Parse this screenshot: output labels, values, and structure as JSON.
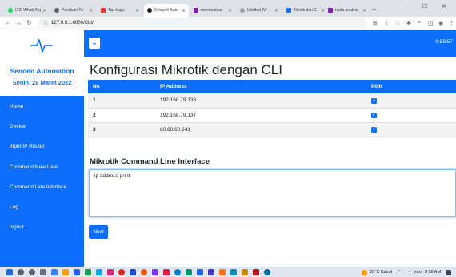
{
  "browser": {
    "tabs": [
      {
        "label": "(12) WhatsApp",
        "color": "#25d366"
      },
      {
        "label": "Panduan TA",
        "color": "#5f6368"
      },
      {
        "label": "Top Lagu",
        "color": "#e53935"
      },
      {
        "label": "Network Auto",
        "color": "#202124"
      },
      {
        "label": "membuat ar",
        "color": "#7b1fa2"
      },
      {
        "label": "Untitled (Vi",
        "color": "#9e9e9e"
      },
      {
        "label": "Teknik dan C",
        "color": "#1a73e8"
      },
      {
        "label": "nada anak ar",
        "color": "#7b1fa2"
      }
    ],
    "new_tab": "+",
    "minimize": "—",
    "maximize": "☐",
    "close": "✕",
    "url": "127.0.0.1:8000/CLI/"
  },
  "sidebar": {
    "brand_name": "Senden Automation",
    "date": "Senin, 28 Maret 2022",
    "items": [
      {
        "label": "Home"
      },
      {
        "label": "Device"
      },
      {
        "label": "Input IP Router"
      },
      {
        "label": "Command New User"
      },
      {
        "label": "Command Line Interface"
      },
      {
        "label": "Log"
      },
      {
        "label": "logout"
      }
    ]
  },
  "topbar": {
    "toggle": "≡",
    "clock": "9:59:57"
  },
  "main": {
    "title": "Konfigurasi Mikrotik dengan CLI",
    "table": {
      "headers": [
        "No",
        "IP Address",
        "Pilih"
      ],
      "rows": [
        {
          "no": "1",
          "ip": "192.168.79.136",
          "checked": true
        },
        {
          "no": "2",
          "ip": "192.168.79.137",
          "checked": true
        },
        {
          "no": "3",
          "ip": "60.60.60.241",
          "checked": true
        }
      ]
    },
    "cli_title": "Mikrotik Command Line Interface",
    "cli_value": "ip address print",
    "next_label": "Next"
  },
  "taskbar": {
    "weather": "29°C Kabut",
    "lang": "ENG",
    "time": "9:59 AM"
  },
  "colors": {
    "primary": "#0d6efd"
  }
}
